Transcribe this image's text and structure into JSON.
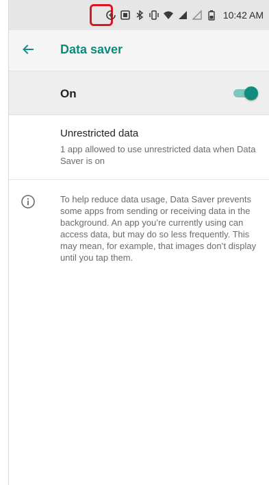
{
  "status_bar": {
    "time": "10:42 AM",
    "icons": [
      "data-saver-icon",
      "nfc-icon",
      "bluetooth-icon",
      "vibrate-icon",
      "wifi-icon",
      "signal-icon",
      "signal-empty-icon",
      "battery-icon"
    ],
    "highlight_color": "#e0141e"
  },
  "app_bar": {
    "back_icon": "arrow-left-icon",
    "title": "Data saver",
    "accent_color": "#0d8a7a"
  },
  "master_switch": {
    "label": "On",
    "checked": true,
    "thumb_color": "#128c7e",
    "track_color": "#7fc7bd"
  },
  "unrestricted": {
    "title": "Unrestricted data",
    "summary": "1 app allowed to use unrestricted data when Data Saver is on"
  },
  "footer": {
    "icon": "info-icon",
    "text": "To help reduce data usage, Data Saver prevents some apps from sending or receiving data in the background. An app you’re currently using can access data, but may do so less frequently. This may mean, for example, that images don’t display until you tap them."
  }
}
